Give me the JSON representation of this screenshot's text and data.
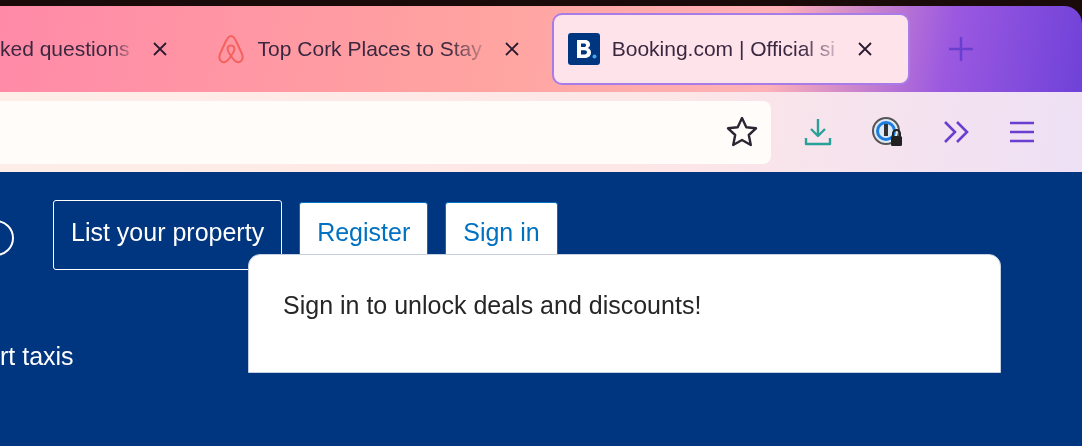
{
  "tabs": [
    {
      "title": "ked questions",
      "selected": false
    },
    {
      "title": "Top Cork Places to Stay",
      "selected": false
    },
    {
      "title": "Booking.com | Official si",
      "selected": true
    }
  ],
  "page": {
    "buttons": [
      {
        "label": "List your property",
        "kind": "outline"
      },
      {
        "label": "Register",
        "kind": "filled"
      },
      {
        "label": "Sign in",
        "kind": "filled"
      }
    ],
    "nav_text": "rt taxis",
    "popup": {
      "message": "Sign in to unlock deals and discounts!"
    }
  }
}
